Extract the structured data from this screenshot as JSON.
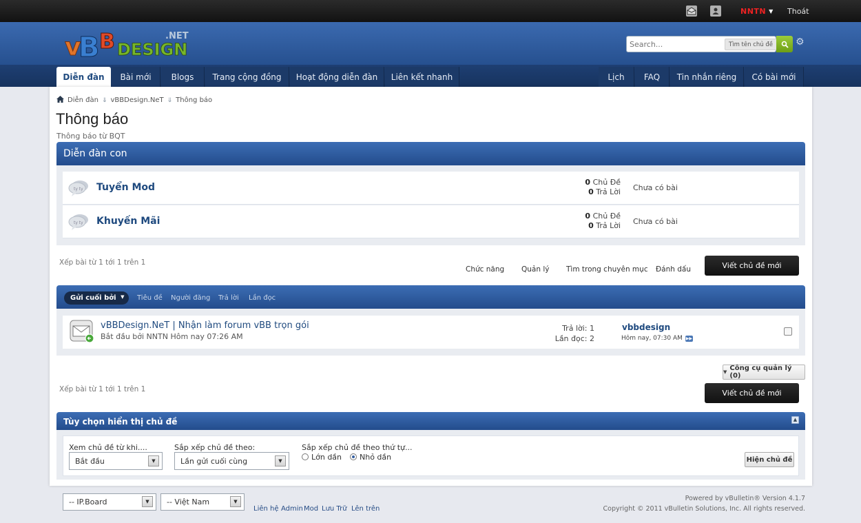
{
  "topbar": {
    "inbox_icon": "envelope-icon",
    "user_icon": "user-card-icon",
    "username": "NNTN",
    "logout": "Thoát"
  },
  "header": {
    "logo_text": "vBBDesign.NET",
    "search_placeholder": "Search...",
    "search_threads_label": "Tìm tên chủ đề",
    "search_go_icon": "magnifier-icon",
    "settings_icon": "gear-icon"
  },
  "nav": {
    "left_tabs": [
      "Diễn đàn",
      "Bài mới",
      "Blogs",
      "Trang cộng đồng",
      "Hoạt động diễn đàn",
      "Liên kết nhanh"
    ],
    "right_tabs": [
      "Lịch",
      "FAQ",
      "Tin nhắn riêng",
      "Có bài mới"
    ]
  },
  "breadcrumb": [
    "Diễn đàn",
    "vBBDesign.NeT",
    "Thông báo"
  ],
  "page": {
    "title": "Thông báo",
    "description": "Thông báo từ BQT"
  },
  "subforums": {
    "title": "Diễn đàn con",
    "items": [
      {
        "name": "Tuyển Mod",
        "threads": "0",
        "threads_label": "Chủ Đề",
        "posts": "0",
        "posts_label": "Trả Lời",
        "last_post": "Chưa có bài"
      },
      {
        "name": "Khuyến Mãi",
        "threads": "0",
        "threads_label": "Chủ Đề",
        "posts": "0",
        "posts_label": "Trả Lời",
        "last_post": "Chưa có bài"
      }
    ]
  },
  "pager_text": "Xếp bài từ 1 tới 1 trên 1",
  "actions": [
    "Chức năng",
    "Quản lý",
    "Tìm trong chuyên mục",
    "Đánh dấu"
  ],
  "new_thread_button": "Viết chủ đề mới",
  "threadlist": {
    "sort_active": "Gửi cuối bởi",
    "sort_columns": [
      "Tiêu đề",
      "Người đăng",
      "Trả lời",
      "Lần đọc"
    ],
    "threads": [
      {
        "title": "vBBDesign.NeT | Nhận làm forum vBB trọn gói",
        "started": "Bắt đầu bởi NNTN Hôm nay 07:26 AM",
        "replies_label": "Trả lời:",
        "replies": "1",
        "views_label": "Lần đọc:",
        "views": "2",
        "last_user": "vbbdesign",
        "last_time": "Hôm nay, 07:30 AM"
      }
    ]
  },
  "mod_tools": "Công cụ quản lý (0)",
  "display_options": {
    "title": "Tùy chọn hiển thị chủ đề",
    "from_label": "Xem chủ đề từ khi....",
    "from_value": "Bắt đầu",
    "sort_label": "Sắp xếp chủ đề theo:",
    "sort_value": "Lần gửi cuối cùng",
    "order_label": "Sắp xếp chủ đề theo thứ tự...",
    "order_asc": "Lớn dần",
    "order_desc": "Nhỏ dần",
    "order_selected": "desc",
    "submit": "Hiện chủ đề"
  },
  "footer": {
    "style_select": "-- IP.Board",
    "language_select": "-- Việt Nam",
    "links": [
      "Liên hệ",
      "Admin",
      "Mod",
      "Lưu Trữ",
      "Lên trên"
    ],
    "powered": "Powered by vBulletin® Version 4.1.7",
    "copyright": "Copyright © 2011 vBulletin Solutions, Inc. All rights reserved."
  },
  "colors": {
    "header_blue": "#2f5c9f",
    "nav_dark": "#1b3965",
    "link_blue": "#1f4a7f",
    "search_green": "#7fb125",
    "username_red": "#ee2222"
  }
}
